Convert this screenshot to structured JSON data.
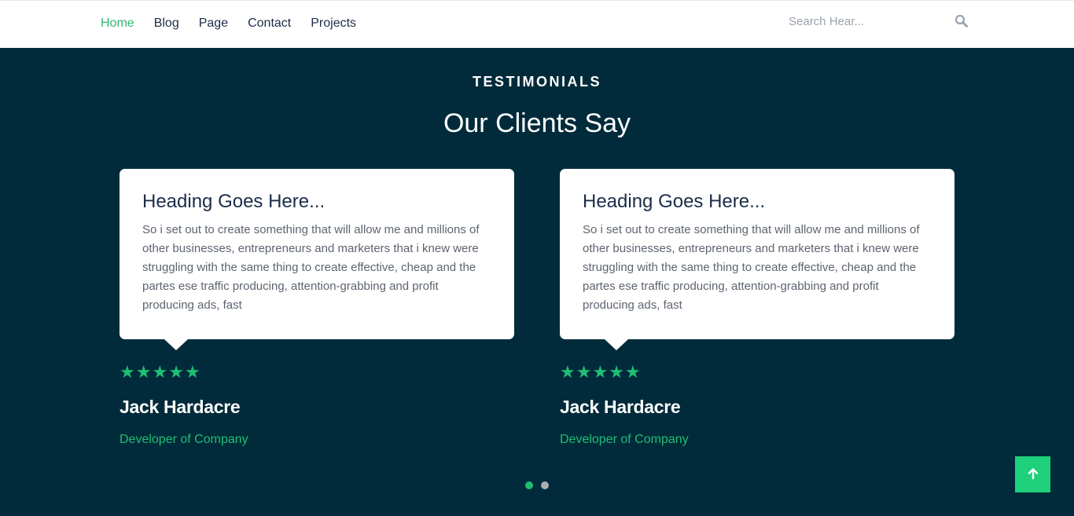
{
  "nav": {
    "items": [
      {
        "label": "Home",
        "active": true
      },
      {
        "label": "Blog",
        "active": false
      },
      {
        "label": "Page",
        "active": false
      },
      {
        "label": "Contact",
        "active": false
      },
      {
        "label": "Projects",
        "active": false
      }
    ],
    "search": {
      "placeholder": "Search Hear...",
      "value": "",
      "icon": "search-icon"
    }
  },
  "section": {
    "eyebrow": "TESTIMONIALS",
    "title": "Our Clients Say"
  },
  "testimonials": [
    {
      "heading": "Heading Goes Here...",
      "text": "So i set out to create something that will allow me and millions of other businesses, entrepreneurs and marketers that i knew were struggling with the same thing to create effective, cheap and the partes ese traffic producing, attention-grabbing and profit producing ads, fast",
      "rating": 5,
      "name": "Jack Hardacre",
      "role": "Developer of Company"
    },
    {
      "heading": "Heading Goes Here...",
      "text": "So i set out to create something that will allow me and millions of other businesses, entrepreneurs and marketers that i knew were struggling with the same thing to create effective, cheap and the partes ese traffic producing, attention-grabbing and profit producing ads, fast",
      "rating": 5,
      "name": "Jack Hardacre",
      "role": "Developer of Company"
    }
  ],
  "carousel": {
    "pages": 2,
    "active_index": 0
  },
  "back_to_top": {
    "icon": "arrow-up-icon"
  },
  "colors": {
    "accent": "#1fbf72",
    "background": "#012b3b",
    "nav_active": "#2eb872",
    "heading_text": "#1c2d4a"
  }
}
